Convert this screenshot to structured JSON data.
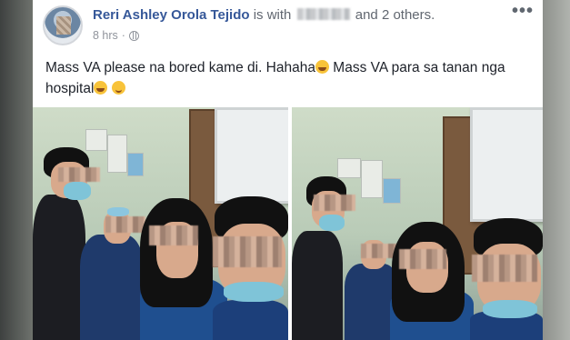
{
  "post": {
    "author": "Reri Ashley Orola Tejido",
    "is_with": "is with",
    "others": "and 2 others.",
    "time": "8 hrs",
    "separator": "·",
    "more_glyph": "•••",
    "text_part1": "Mass VA please na bored kame di. Hahaha",
    "text_part2": " Mass VA para sa tanan nga hospital",
    "privacy_icon": "globe-icon",
    "emojis": [
      "rofl-emoji",
      "rofl-emoji",
      "smile-emoji"
    ]
  },
  "colors": {
    "author_link": "#365899",
    "text": "#1d2129",
    "meta": "#90949c"
  }
}
